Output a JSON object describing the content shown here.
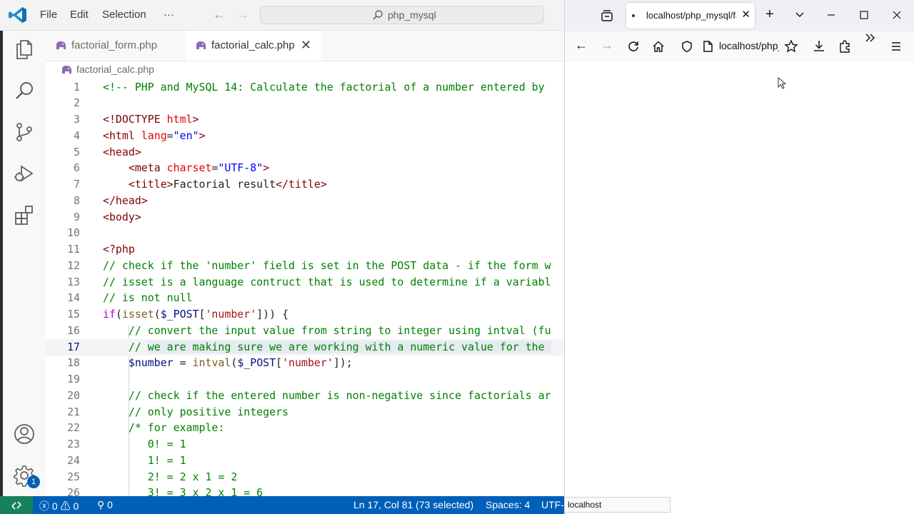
{
  "vscode": {
    "menu": [
      "File",
      "Edit",
      "Selection",
      "···"
    ],
    "search_text": "php_mysql",
    "tabs": [
      {
        "label": "factorial_form.php",
        "active": false
      },
      {
        "label": "factorial_calc.php",
        "active": true
      }
    ],
    "breadcrumb": "factorial_calc.php",
    "activity_icons": [
      "explorer-icon",
      "search-icon",
      "source-control-icon",
      "run-debug-icon",
      "extensions-icon",
      "account-icon",
      "settings-gear-icon"
    ],
    "settings_badge": "1",
    "lines": [
      {
        "n": "1",
        "tokens": [
          [
            "com",
            "<!-- PHP and MySQL 14: Calculate the factorial of a number entered by"
          ]
        ]
      },
      {
        "n": "2",
        "tokens": []
      },
      {
        "n": "3",
        "tokens": [
          [
            "tag",
            "<!DOCTYPE "
          ],
          [
            "attr",
            "html"
          ],
          [
            "tag",
            ">"
          ]
        ]
      },
      {
        "n": "4",
        "tokens": [
          [
            "tag",
            "<html "
          ],
          [
            "attr",
            "lang"
          ],
          [
            "plain",
            "="
          ],
          [
            "str",
            "\"en\""
          ],
          [
            "tag",
            ">"
          ]
        ]
      },
      {
        "n": "5",
        "tokens": [
          [
            "tag",
            "<head>"
          ]
        ]
      },
      {
        "n": "6",
        "tokens": [
          [
            "plain",
            "    "
          ],
          [
            "tag",
            "<meta "
          ],
          [
            "attr",
            "charset"
          ],
          [
            "plain",
            "="
          ],
          [
            "str",
            "\"UTF-8\""
          ],
          [
            "tag",
            ">"
          ]
        ]
      },
      {
        "n": "7",
        "tokens": [
          [
            "plain",
            "    "
          ],
          [
            "tag",
            "<title>"
          ],
          [
            "plain",
            "Factorial result"
          ],
          [
            "tag",
            "</title>"
          ]
        ]
      },
      {
        "n": "8",
        "tokens": [
          [
            "tag",
            "</head>"
          ]
        ]
      },
      {
        "n": "9",
        "tokens": [
          [
            "tag",
            "<body>"
          ]
        ]
      },
      {
        "n": "10",
        "tokens": []
      },
      {
        "n": "11",
        "tokens": [
          [
            "meta",
            "<?php"
          ]
        ]
      },
      {
        "n": "12",
        "tokens": [
          [
            "com",
            "// check if the 'number' field is set in the POST data - if the form w"
          ]
        ]
      },
      {
        "n": "13",
        "tokens": [
          [
            "com",
            "// isset is a language contruct that is used to determine if a variabl"
          ]
        ]
      },
      {
        "n": "14",
        "tokens": [
          [
            "com",
            "// is not null"
          ]
        ]
      },
      {
        "n": "15",
        "tokens": [
          [
            "kw",
            "if"
          ],
          [
            "plain",
            "("
          ],
          [
            "fn",
            "isset"
          ],
          [
            "plain",
            "("
          ],
          [
            "var",
            "$_POST"
          ],
          [
            "plain",
            "["
          ],
          [
            "str2",
            "'number'"
          ],
          [
            "plain",
            "])) {"
          ]
        ]
      },
      {
        "n": "16",
        "tokens": [
          [
            "plain",
            "    "
          ],
          [
            "com",
            "// convert the input value from string to integer using intval (fu"
          ]
        ]
      },
      {
        "n": "17",
        "current": true,
        "tokens": [
          [
            "plain",
            "    "
          ],
          [
            "com",
            "// "
          ],
          [
            "comsel",
            "we are making sure we are working with a numeric value for the "
          ]
        ]
      },
      {
        "n": "18",
        "tokens": [
          [
            "plain",
            "    "
          ],
          [
            "var",
            "$number"
          ],
          [
            "plain",
            " = "
          ],
          [
            "fn",
            "intval"
          ],
          [
            "plain",
            "("
          ],
          [
            "var",
            "$_POST"
          ],
          [
            "plain",
            "["
          ],
          [
            "str2",
            "'number'"
          ],
          [
            "plain",
            "]);"
          ]
        ]
      },
      {
        "n": "19",
        "tokens": []
      },
      {
        "n": "20",
        "tokens": [
          [
            "plain",
            "    "
          ],
          [
            "com",
            "// check if the entered number is non-negative since factorials ar"
          ]
        ]
      },
      {
        "n": "21",
        "tokens": [
          [
            "plain",
            "    "
          ],
          [
            "com",
            "// only positive integers"
          ]
        ]
      },
      {
        "n": "22",
        "tokens": [
          [
            "plain",
            "    "
          ],
          [
            "com",
            "/* for example:"
          ]
        ]
      },
      {
        "n": "23",
        "tokens": [
          [
            "plain",
            "    "
          ],
          [
            "com",
            "   0! = 1"
          ]
        ]
      },
      {
        "n": "24",
        "tokens": [
          [
            "plain",
            "    "
          ],
          [
            "com",
            "   1! = 1"
          ]
        ]
      },
      {
        "n": "25",
        "tokens": [
          [
            "plain",
            "    "
          ],
          [
            "com",
            "   2! = 2 x 1 = 2"
          ]
        ]
      },
      {
        "n": "26",
        "tokens": [
          [
            "plain",
            "    "
          ],
          [
            "com",
            "   3! = 3 x 2 x 1 = 6"
          ]
        ]
      }
    ],
    "status": {
      "errors": "0",
      "warnings": "0",
      "ports": "0",
      "position": "Ln 17, Col 81 (73 selected)",
      "spaces": "Spaces: 4",
      "encoding": "UTF-"
    }
  },
  "browser": {
    "tab_title": "localhost/php_mysql/factorial_calc.php",
    "url": "localhost/php_mysql/factorial_calc.php",
    "status_text": "localhost"
  },
  "colors": {
    "status_bar": "#005fb8",
    "remote_indicator": "#16825d",
    "comment": "#008000",
    "tag": "#800000",
    "attribute": "#e50000",
    "string": "#0000ff"
  }
}
